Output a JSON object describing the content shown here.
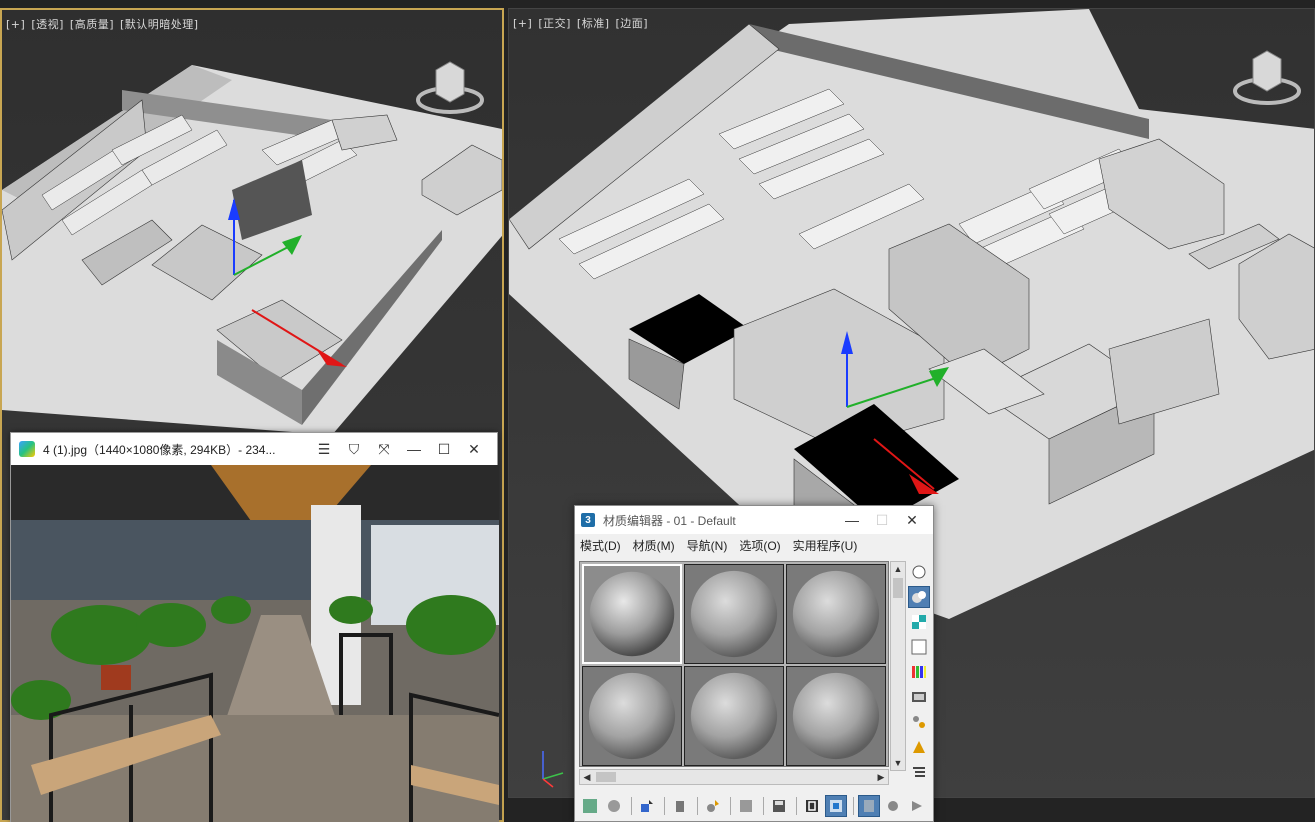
{
  "left_viewport": {
    "labels": [
      "[+]",
      "[透视]",
      "[高质量]",
      "[默认明暗处理]"
    ]
  },
  "right_viewport": {
    "labels": [
      "[+]",
      "[正交]",
      "[标准]",
      "[边面]"
    ]
  },
  "image_viewer": {
    "title": "4 (1).jpg（1440×1080像素, 294KB）- 234...",
    "buttons": {
      "menu": "☰",
      "skin": "⛉",
      "fullscreen": "⤧",
      "minimize": "—",
      "maximize": "☐",
      "close": "✕"
    }
  },
  "material_editor": {
    "app_icon": "3",
    "title": "材质编辑器 - 01 - Default",
    "window_buttons": {
      "minimize": "—",
      "maximize": "☐",
      "close": "✕"
    },
    "menu": [
      "模式(D)",
      "材质(M)",
      "导航(N)",
      "选项(O)",
      "实用程序(U)"
    ],
    "scroll_arrows": {
      "up": "▲",
      "down": "▼",
      "left": "◀",
      "right": "▶"
    }
  },
  "colors": {
    "active_viewport_border": "#c8a652",
    "viewport_bg": "#3a3a3a",
    "floor": "#d9d9d9",
    "selected_tool": "#4f7fb3"
  }
}
